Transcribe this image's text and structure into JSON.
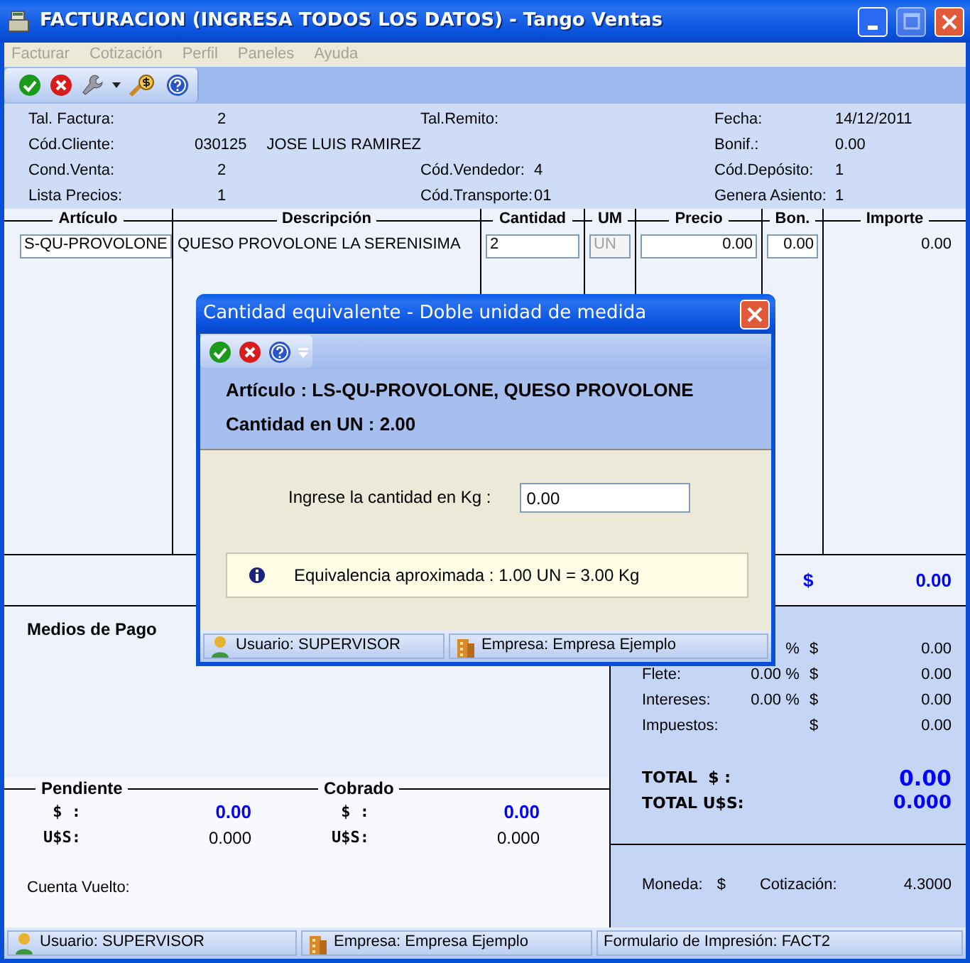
{
  "window": {
    "title": "FACTURACION (INGRESA TODOS LOS DATOS) - Tango Ventas"
  },
  "menu": [
    {
      "label": "Facturar",
      "disabled": true
    },
    {
      "label": "Cotización",
      "disabled": true
    },
    {
      "label": "Perfil",
      "disabled": true
    },
    {
      "label": "Paneles",
      "disabled": true
    },
    {
      "label": "Ayuda",
      "disabled": true
    }
  ],
  "header": [
    {
      "left": {
        "label": "Tal. Factura:",
        "value": "2"
      },
      "middle": {
        "label": "Tal.Remito:"
      },
      "right": {
        "label": "Fecha:",
        "value": "14/12/2011"
      }
    },
    {
      "left": {
        "label": "Cód.Cliente:",
        "value": "030125",
        "extra": "JOSE LUIS RAMIREZ"
      },
      "right": {
        "label": "Bonif.:",
        "value": "0.00"
      }
    },
    {
      "left": {
        "label": "Cond.Venta:",
        "value": "2"
      },
      "middle": {
        "label": "Cód.Vendedor:",
        "value": "4"
      },
      "right": {
        "label": "Cód.Depósito:",
        "value": "1"
      }
    },
    {
      "left": {
        "label": "Lista Precios:",
        "value": "1"
      },
      "middle": {
        "label": "Cód.Transporte:",
        "value": "01"
      },
      "right": {
        "label": "Genera Asiento:",
        "value": "1"
      }
    }
  ],
  "grid": {
    "columns": [
      "Artículo",
      "Descripción",
      "Cantidad",
      "UM",
      "Precio",
      "Bon.",
      "Importe"
    ],
    "rows": [
      {
        "cells": [
          {
            "kind": "field",
            "value": "S-QU-PROVOLONE",
            "disabled": false
          },
          {
            "kind": "text",
            "value": "QUESO PROVOLONE LA SERENISIMA"
          },
          {
            "kind": "field",
            "value": "2",
            "disabled": false
          },
          {
            "kind": "field",
            "value": "UN",
            "disabled": true
          },
          {
            "kind": "field",
            "value": "0.00",
            "disabled": false
          },
          {
            "kind": "field",
            "value": "0.00",
            "disabled": false
          },
          {
            "kind": "text",
            "value": "0.00"
          }
        ]
      }
    ]
  },
  "subtotal": {
    "currency": "$",
    "value": "0.00"
  },
  "payments": {
    "title": "Medios de Pago",
    "groups": [
      {
        "title": "Pendiente",
        "rows": [
          {
            "label": "$ :",
            "value": "0.00",
            "kind": "main"
          },
          {
            "label": "U$S:",
            "value": "0.000",
            "kind": "secondary"
          }
        ]
      },
      {
        "title": "Cobrado",
        "rows": [
          {
            "label": "$ :",
            "value": "0.00",
            "kind": "main"
          },
          {
            "label": "U$S:",
            "value": "0.000",
            "kind": "secondary"
          }
        ]
      }
    ],
    "change_label": "Cuenta Vuelto:"
  },
  "totals": {
    "rows": [
      {
        "percent_sign": "%",
        "currency": "$",
        "amount": "0.00"
      },
      {
        "label": "Flete:",
        "percent": "0.00",
        "percent_sign": "%",
        "currency": "$",
        "amount": "0.00"
      },
      {
        "label": "Intereses:",
        "percent": "0.00",
        "percent_sign": "%",
        "currency": "$",
        "amount": "0.00"
      },
      {
        "label": "Impuestos:",
        "currency": "$",
        "amount": "0.00"
      }
    ],
    "grand": [
      {
        "label": "TOTAL  $ :",
        "value": "0.00",
        "kind": "main"
      },
      {
        "label": "TOTAL U$S:",
        "value": "0.000",
        "kind": "secondary"
      }
    ],
    "currency_label": "Moneda:",
    "currency": "$",
    "rate_label": "Cotización:",
    "rate": "4.3000"
  },
  "status_bar": [
    {
      "text": "Usuario: SUPERVISOR",
      "kind": "user"
    },
    {
      "text": "Empresa: Empresa Ejemplo",
      "kind": "company"
    },
    {
      "text": "Formulario de Impresión: FACT2",
      "kind": "plain"
    }
  ],
  "dialog": {
    "title": "Cantidad equivalente - Doble unidad de medida",
    "article": "Artículo : LS-QU-PROVOLONE, QUESO PROVOLONE",
    "quantity": "Cantidad en UN : 2.00",
    "prompt": "Ingrese la cantidad en Kg :",
    "value": "0.00",
    "info": "Equivalencia aproximada : 1.00 UN = 3.00 Kg",
    "status_bar": [
      {
        "text": "Usuario: SUPERVISOR",
        "kind": "user"
      },
      {
        "text": "Empresa: Empresa Ejemplo",
        "kind": "company"
      }
    ]
  }
}
